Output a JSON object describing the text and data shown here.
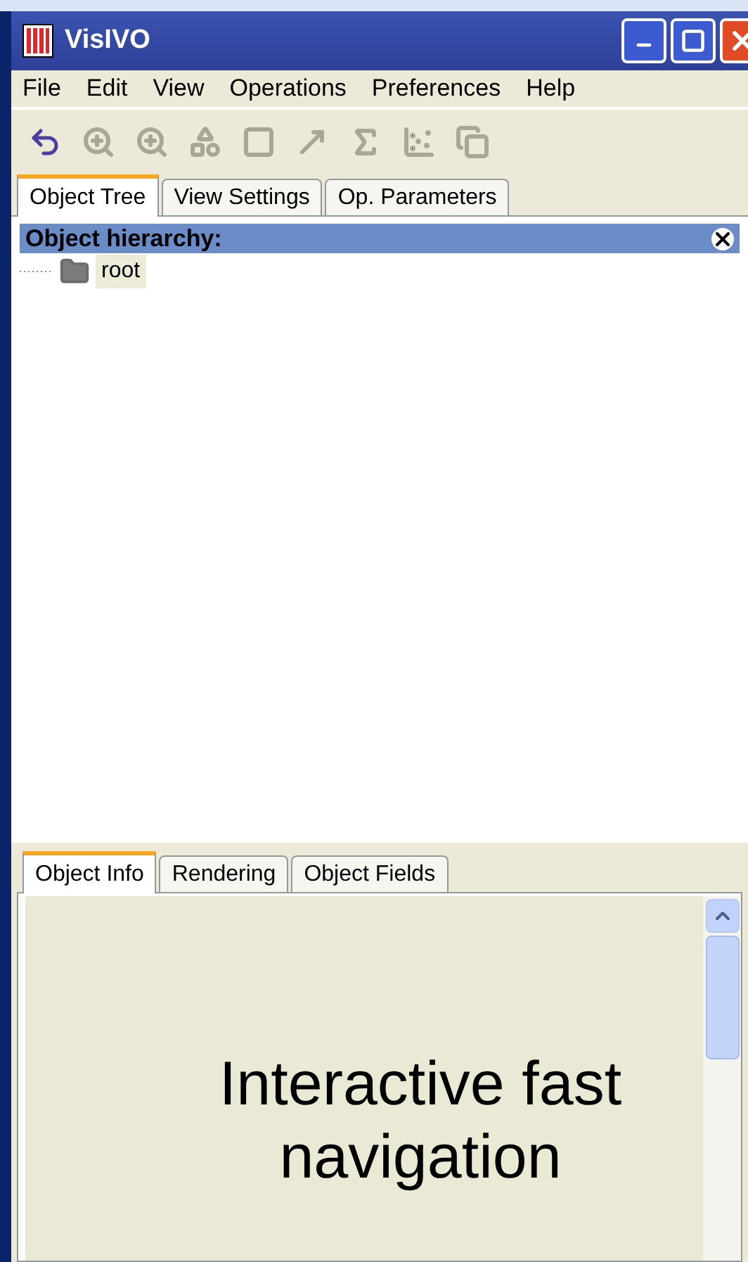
{
  "window": {
    "title": "VisIVO"
  },
  "menu": [
    "File",
    "Edit",
    "View",
    "Operations",
    "Preferences",
    "Help"
  ],
  "toolbar": [
    {
      "kind": "undo",
      "disabled": false
    },
    {
      "kind": "zoom-all",
      "disabled": true
    },
    {
      "kind": "zoom-selection",
      "disabled": true
    },
    {
      "kind": "cluster",
      "disabled": true
    },
    {
      "kind": "shape",
      "disabled": true
    },
    {
      "kind": "arrow-plus",
      "disabled": true
    },
    {
      "kind": "function",
      "disabled": true
    },
    {
      "kind": "scatter",
      "disabled": true
    },
    {
      "kind": "copy",
      "disabled": true
    }
  ],
  "top_tabs": [
    {
      "label": "Object Tree",
      "selected": true
    },
    {
      "label": "View Settings",
      "selected": false
    },
    {
      "label": "Op. Parameters",
      "selected": false
    }
  ],
  "object_hierarchy": {
    "title": "Object hierarchy:",
    "items": [
      {
        "label": "root",
        "selected": true
      }
    ]
  },
  "bottom_tabs": [
    {
      "label": "Object Info",
      "selected": true
    },
    {
      "label": "Rendering",
      "selected": false
    },
    {
      "label": "Object Fields",
      "selected": false
    }
  ],
  "caption": "Interactive fast navigation"
}
